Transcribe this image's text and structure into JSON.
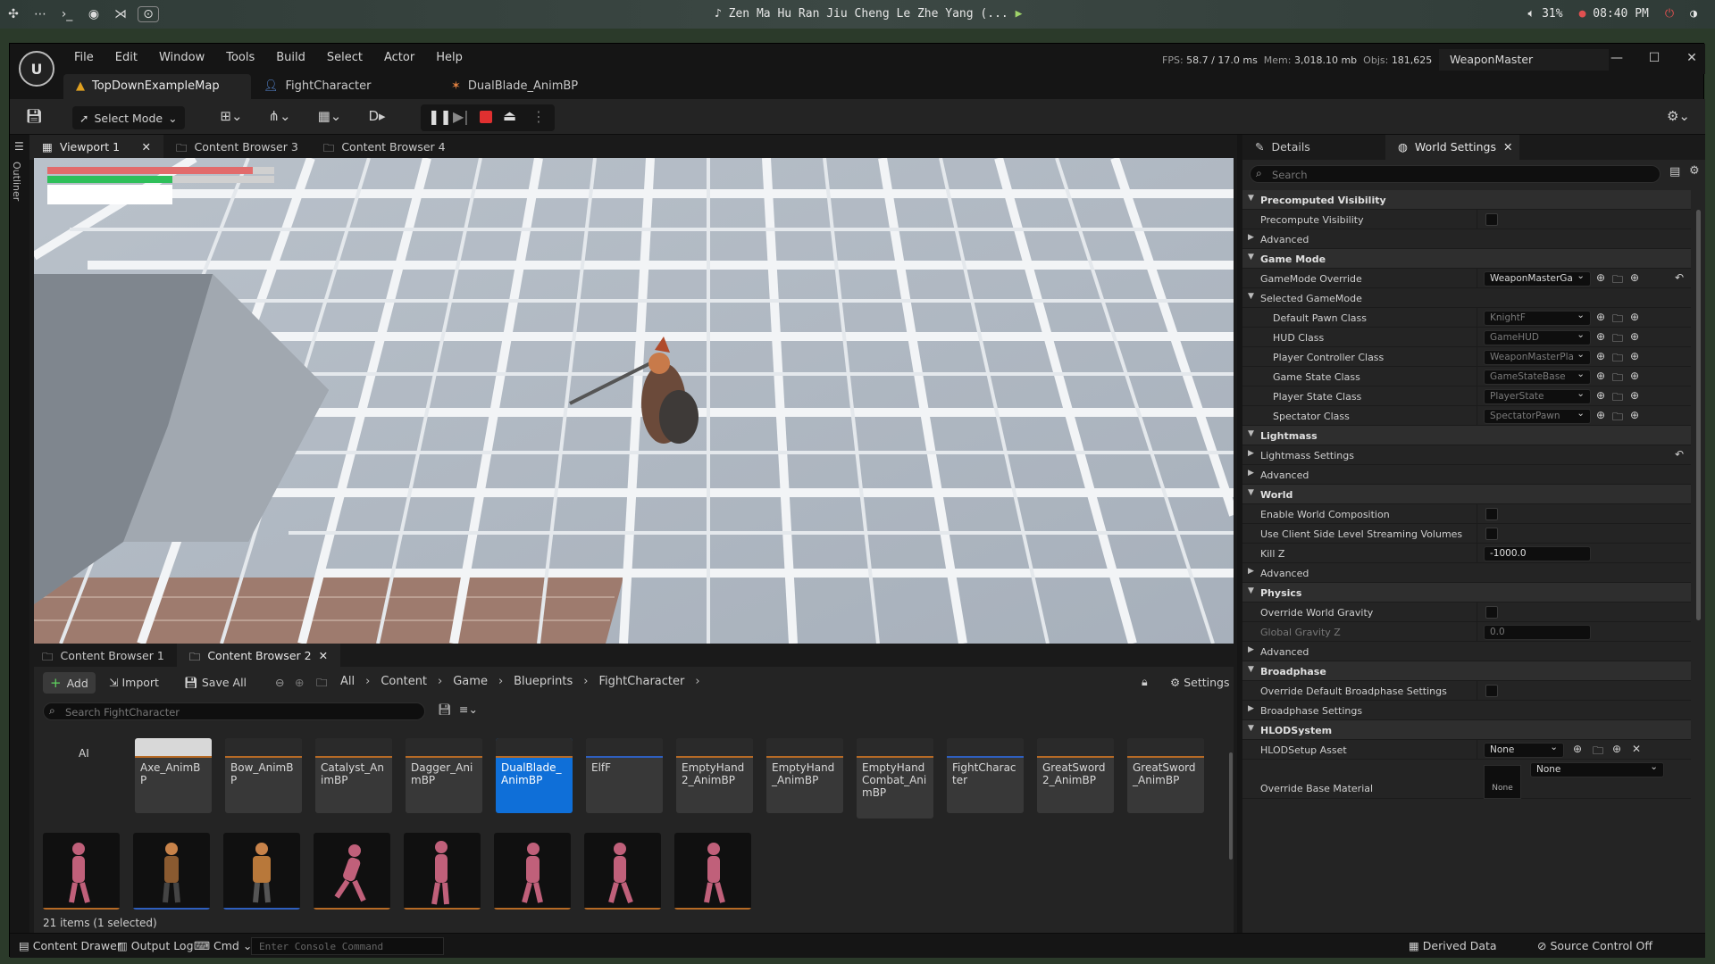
{
  "os": {
    "media_title": "Zen Ma Hu Ran Jiu Cheng Le Zhe Yang (...",
    "battery": "31%",
    "time": "08:40 PM"
  },
  "app": {
    "menu": [
      "File",
      "Edit",
      "Window",
      "Tools",
      "Build",
      "Select",
      "Actor",
      "Help"
    ],
    "stats": {
      "fps_label": "FPS:",
      "fps": "58.7",
      "ms": "/ 17.0 ms",
      "mem_label": "Mem:",
      "mem": "3,018.10 mb",
      "objs_label": "Objs:",
      "objs": "181,625"
    },
    "project": "WeaponMaster",
    "doc_tabs": [
      "TopDownExampleMap",
      "FightCharacter",
      "DualBlade_AnimBP"
    ]
  },
  "toolbar": {
    "select_mode": "Select Mode"
  },
  "viewport_tabs": [
    "Viewport 1",
    "Content Browser 3",
    "Content Browser 4"
  ],
  "outliner_label": "Outliner",
  "content_browser": {
    "tabs": [
      "Content Browser 1",
      "Content Browser 2"
    ],
    "add": "Add",
    "import": "Import",
    "save_all": "Save All",
    "breadcrumb": [
      "All",
      "Content",
      "Game",
      "Blueprints",
      "FightCharacter"
    ],
    "settings": "Settings",
    "search_placeholder": "Search FightCharacter",
    "folder_label": "AI",
    "assets": [
      "Axe_AnimBP",
      "Bow_AnimBP",
      "Catalyst_AnimBP",
      "Dagger_AnimBP",
      "DualBlade_AnimBP",
      "ElfF",
      "EmptyHand2_AnimBP",
      "EmptyHand_AnimBP",
      "EmptyHandCombat_AnimBP",
      "FightCharacter",
      "GreatSword2_AnimBP",
      "GreatSword_AnimBP"
    ],
    "item_count": "21 items (1 selected)"
  },
  "details": {
    "tabs": [
      "Details",
      "World Settings"
    ],
    "search_placeholder": "Search",
    "rows": {
      "precomputed_visibility": "Precomputed Visibility",
      "precompute_visibility": "Precompute Visibility",
      "advanced": "Advanced",
      "game_mode": "Game Mode",
      "gamemode_override": "GameMode Override",
      "gamemode_override_val": "WeaponMasterGa",
      "selected_gamemode": "Selected GameMode",
      "default_pawn": "Default Pawn Class",
      "default_pawn_val": "KnightF",
      "hud": "HUD Class",
      "hud_val": "GameHUD",
      "player_controller": "Player Controller Class",
      "player_controller_val": "WeaponMasterPla",
      "game_state": "Game State Class",
      "game_state_val": "GameStateBase",
      "player_state": "Player State Class",
      "player_state_val": "PlayerState",
      "spectator": "Spectator Class",
      "spectator_val": "SpectatorPawn",
      "lightmass": "Lightmass",
      "lightmass_settings": "Lightmass Settings",
      "world": "World",
      "enable_world_comp": "Enable World Composition",
      "client_side_streaming": "Use Client Side Level Streaming Volumes",
      "kill_z": "Kill Z",
      "kill_z_val": "-1000.0",
      "physics": "Physics",
      "override_gravity": "Override World Gravity",
      "global_gravity": "Global Gravity Z",
      "global_gravity_val": "0.0",
      "broadphase": "Broadphase",
      "override_broadphase": "Override Default Broadphase Settings",
      "broadphase_settings": "Broadphase Settings",
      "hlod": "HLODSystem",
      "hlod_setup": "HLODSetup Asset",
      "hlod_setup_val": "None",
      "override_base_material": "Override Base Material",
      "override_base_material_val": "None",
      "override_thumb": "None"
    }
  },
  "statusbar": {
    "content_drawer": "Content Drawer",
    "output_log": "Output Log",
    "cmd": "Cmd",
    "console_placeholder": "Enter Console Command",
    "derived_data": "Derived Data",
    "source_control": "Source Control Off"
  },
  "colors": {
    "accent": "#0f6fd8",
    "panel": "#242424",
    "asset_underline": "#b66a25",
    "stop": "#e03030"
  }
}
